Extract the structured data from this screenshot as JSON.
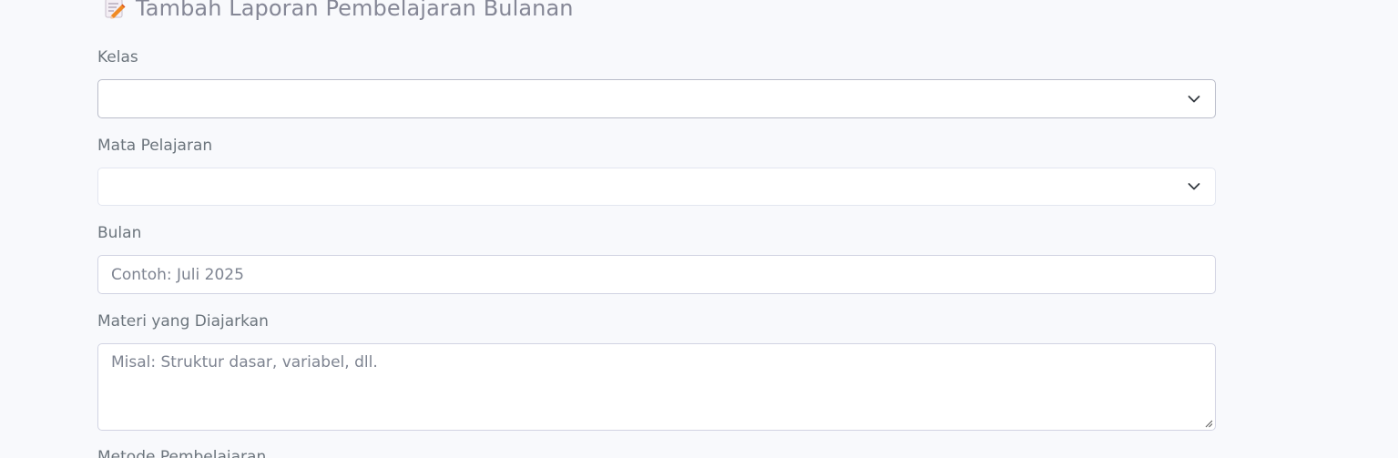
{
  "header": {
    "title": "Tambah Laporan Pembelajaran Bulanan",
    "icon": "memo-icon"
  },
  "form": {
    "kelas": {
      "label": "Kelas",
      "value": ""
    },
    "mata_pelajaran": {
      "label": "Mata Pelajaran",
      "value": ""
    },
    "bulan": {
      "label": "Bulan",
      "placeholder": "Contoh: Juli 2025"
    },
    "materi": {
      "label": "Materi yang Diajarkan",
      "placeholder": "Misal: Struktur dasar, variabel, dll."
    },
    "metode": {
      "label": "Metode Pembelajaran"
    }
  },
  "colors": {
    "background": "#f8f9fc",
    "border": "#d1d3e2",
    "label": "#6c757d",
    "title": "#858796"
  }
}
